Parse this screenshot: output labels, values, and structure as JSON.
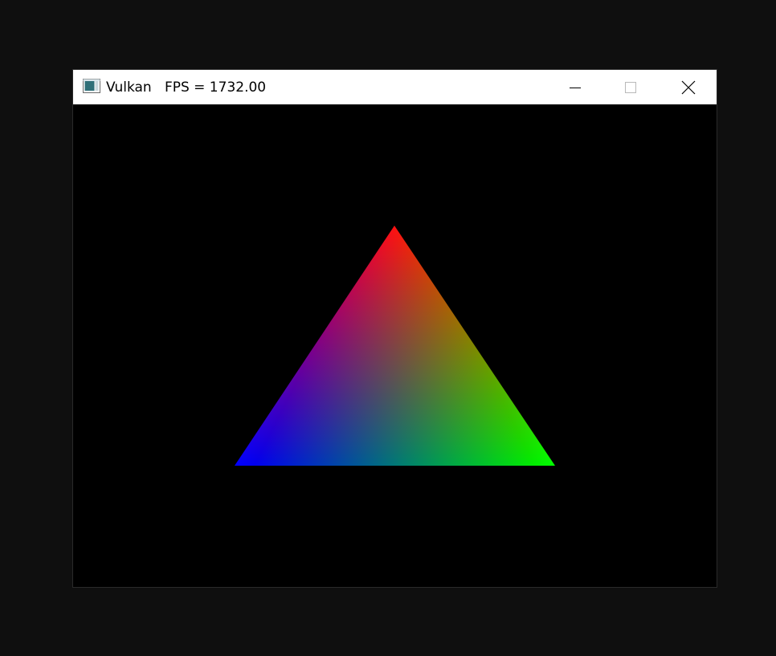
{
  "window": {
    "title": "Vulkan",
    "fps_text": "FPS = 1732.00",
    "controls": {
      "minimize": "minimize-icon",
      "maximize": "maximize-icon",
      "close": "close-icon"
    }
  },
  "scene": {
    "background": "#000000",
    "triangle": {
      "vertex_colors": {
        "top": "#ff0000",
        "bottom_left": "#0000ff",
        "bottom_right": "#00ff00"
      }
    }
  }
}
